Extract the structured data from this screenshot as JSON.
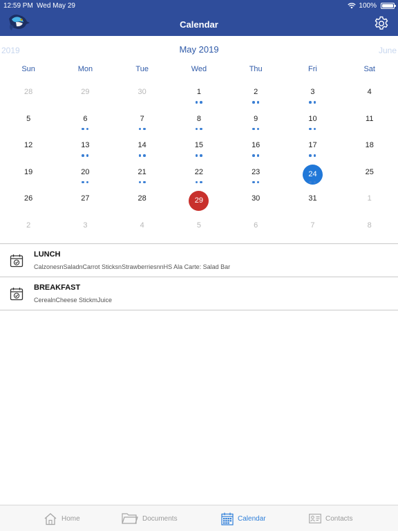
{
  "status_bar": {
    "time": "12:59 PM",
    "date": "Wed May 29",
    "battery": "100%"
  },
  "header": {
    "title": "Calendar"
  },
  "month_nav": {
    "prev": "2019",
    "current": "May 2019",
    "next": "June"
  },
  "weekdays": [
    "Sun",
    "Mon",
    "Tue",
    "Wed",
    "Thu",
    "Fri",
    "Sat"
  ],
  "weeks": [
    [
      {
        "n": "28",
        "muted": true,
        "dots": 0
      },
      {
        "n": "29",
        "muted": true,
        "dots": 0
      },
      {
        "n": "30",
        "muted": true,
        "dots": 0
      },
      {
        "n": "1",
        "dots": 2
      },
      {
        "n": "2",
        "dots": 2
      },
      {
        "n": "3",
        "dots": 2
      },
      {
        "n": "4",
        "dots": 0
      }
    ],
    [
      {
        "n": "5",
        "dots": 0
      },
      {
        "n": "6",
        "dots": 2
      },
      {
        "n": "7",
        "dots": 2
      },
      {
        "n": "8",
        "dots": 2
      },
      {
        "n": "9",
        "dots": 2
      },
      {
        "n": "10",
        "dots": 2
      },
      {
        "n": "11",
        "dots": 0
      }
    ],
    [
      {
        "n": "12",
        "dots": 0
      },
      {
        "n": "13",
        "dots": 2
      },
      {
        "n": "14",
        "dots": 2
      },
      {
        "n": "15",
        "dots": 2
      },
      {
        "n": "16",
        "dots": 2
      },
      {
        "n": "17",
        "dots": 2
      },
      {
        "n": "18",
        "dots": 0
      }
    ],
    [
      {
        "n": "19",
        "dots": 0
      },
      {
        "n": "20",
        "dots": 2
      },
      {
        "n": "21",
        "dots": 2
      },
      {
        "n": "22",
        "dots": 2
      },
      {
        "n": "23",
        "dots": 2
      },
      {
        "n": "24",
        "dots": 2,
        "state": "selected"
      },
      {
        "n": "25",
        "dots": 0
      }
    ],
    [
      {
        "n": "26",
        "dots": 0
      },
      {
        "n": "27",
        "dots": 0
      },
      {
        "n": "28",
        "dots": 0
      },
      {
        "n": "29",
        "dots": 0,
        "state": "today"
      },
      {
        "n": "30",
        "dots": 0
      },
      {
        "n": "31",
        "dots": 0
      },
      {
        "n": "1",
        "muted": true,
        "dots": 0
      }
    ],
    [
      {
        "n": "2",
        "muted": true,
        "dots": 0
      },
      {
        "n": "3",
        "muted": true,
        "dots": 0
      },
      {
        "n": "4",
        "muted": true,
        "dots": 0
      },
      {
        "n": "5",
        "muted": true,
        "dots": 0
      },
      {
        "n": "6",
        "muted": true,
        "dots": 0
      },
      {
        "n": "7",
        "muted": true,
        "dots": 0
      },
      {
        "n": "8",
        "muted": true,
        "dots": 0
      }
    ]
  ],
  "meals": [
    {
      "title": "LUNCH",
      "items": "CalzonesnSaladnCarrot SticksnStrawberriesnnHS Ala Carte:  Salad Bar",
      "icon": "calendar-check-icon"
    },
    {
      "title": "BREAKFAST",
      "items": "CerealnCheese StickmJuice",
      "icon": "calendar-check-icon"
    }
  ],
  "tabs": {
    "home": {
      "label": "Home",
      "icon": "home-icon"
    },
    "documents": {
      "label": "Documents",
      "icon": "folder-icon"
    },
    "calendar": {
      "label": "Calendar",
      "icon": "calendar-icon"
    },
    "contacts": {
      "label": "Contacts",
      "icon": "contact-card-icon"
    }
  },
  "colors": {
    "header": "#2f4d9b",
    "accent": "#2f5aa8",
    "selected": "#2178d8",
    "today": "#c8302c",
    "dot": "#3a7fd4"
  }
}
